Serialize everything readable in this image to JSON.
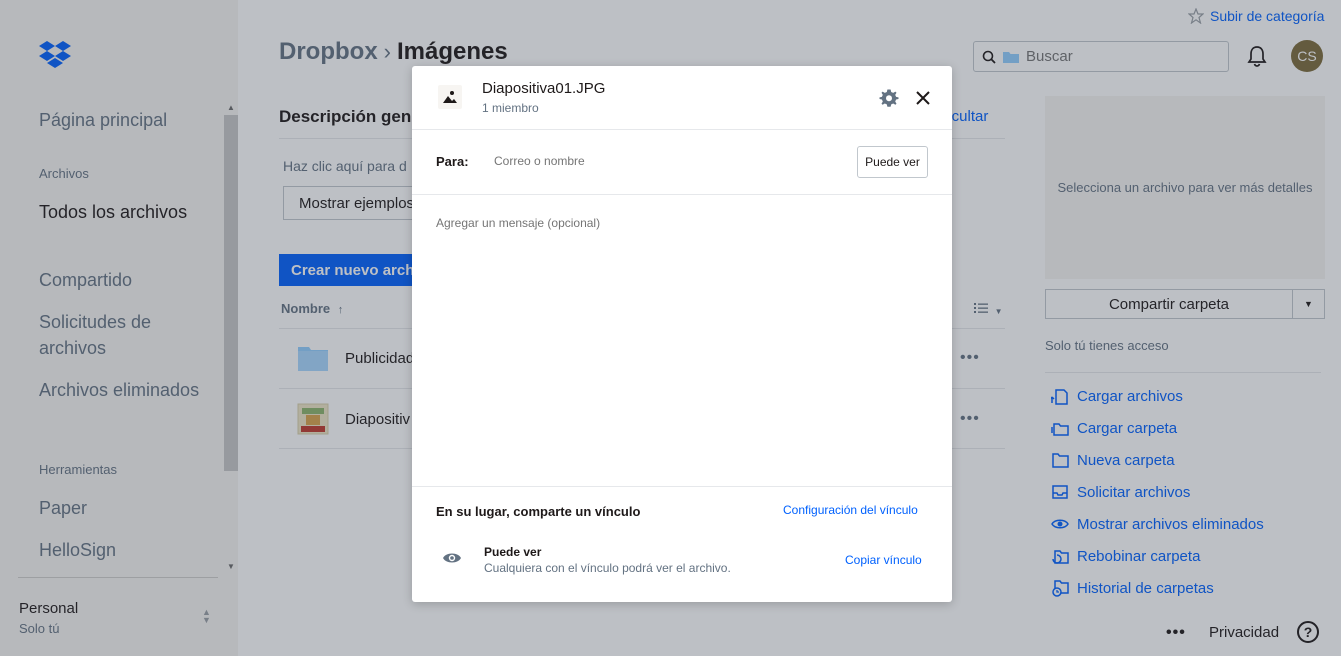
{
  "sidebar": {
    "nav_home": "Página principal",
    "section_files": "Archivos",
    "nav_all_files": "Todos los archivos",
    "nav_shared": "Compartido",
    "nav_file_requests": "Solicitudes de archivos",
    "nav_deleted": "Archivos eliminados",
    "section_tools": "Herramientas",
    "nav_paper": "Paper",
    "nav_hellosign": "HelloSign",
    "account_name": "Personal",
    "account_sub": "Solo tú"
  },
  "header": {
    "upgrade_link": "Subir de categoría",
    "breadcrumb_root": "Dropbox",
    "breadcrumb_current": "Imágenes",
    "search_placeholder": "Buscar",
    "avatar_initials": "CS"
  },
  "main": {
    "description_title": "Descripción gen",
    "hide_link": "Ocultar",
    "description_text": "Haz clic aquí para d",
    "examples_button": "Mostrar ejemplos",
    "create_button": "Crear nuevo archi",
    "column_name": "Nombre",
    "column_sort_arrow": "↑",
    "files": [
      {
        "name": "Publicidad",
        "type": "folder"
      },
      {
        "name": "Diapositiv",
        "type": "image"
      }
    ],
    "row_more": "•••"
  },
  "right_panel": {
    "preview_text": "Selecciona un archivo para ver más detalles",
    "share_button": "Compartir carpeta",
    "access_text": "Solo tú tienes acceso",
    "actions": [
      {
        "label": "Cargar archivos",
        "icon": "upload-file-icon"
      },
      {
        "label": "Cargar carpeta",
        "icon": "upload-folder-icon"
      },
      {
        "label": "Nueva carpeta",
        "icon": "new-folder-icon"
      },
      {
        "label": "Solicitar archivos",
        "icon": "request-files-icon"
      },
      {
        "label": "Mostrar archivos eliminados",
        "icon": "eye-icon"
      },
      {
        "label": "Rebobinar carpeta",
        "icon": "rewind-icon"
      },
      {
        "label": "Historial de carpetas",
        "icon": "history-icon"
      }
    ]
  },
  "footer": {
    "more": "•••",
    "privacy": "Privacidad",
    "help": "?"
  },
  "modal": {
    "file_name": "Diapositiva01.JPG",
    "members": "1 miembro",
    "to_label": "Para:",
    "to_placeholder": "Correo o nombre",
    "permission_button": "Puede ver",
    "message_placeholder": "Agregar un mensaje (opcional)",
    "link_section_title": "En su lugar, comparte un vínculo",
    "link_settings": "Configuración del vínculo",
    "link_permission": "Puede ver",
    "link_description": "Cualquiera con el vínculo podrá ver el archivo.",
    "copy_link": "Copiar vínculo"
  },
  "colors": {
    "accent": "#0061fe",
    "sidebar_bg": "#f7f5f2",
    "muted_text": "#637282",
    "avatar_bg": "#7d6b3a"
  }
}
